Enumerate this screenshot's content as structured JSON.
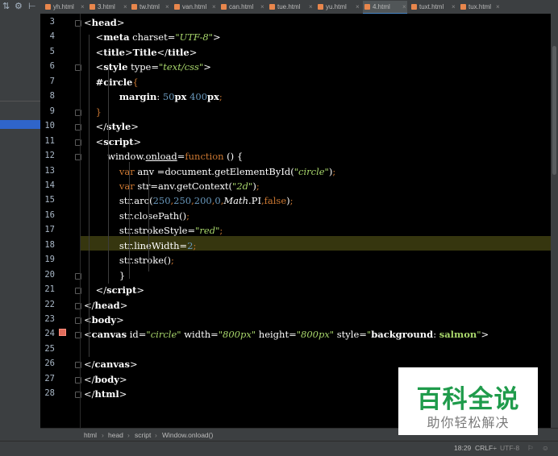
{
  "toolbar": {
    "icons": [
      "⇅",
      "⚙",
      "⊢"
    ]
  },
  "tabs": [
    {
      "label": "yh.html",
      "active": false
    },
    {
      "label": "3.html",
      "active": false
    },
    {
      "label": "tw.html",
      "active": false
    },
    {
      "label": "van.html",
      "active": false
    },
    {
      "label": "can.html",
      "active": false
    },
    {
      "label": "tue.html",
      "active": false
    },
    {
      "label": "yu.html",
      "active": false
    },
    {
      "label": "4.html",
      "active": true
    },
    {
      "label": "tuxt.html",
      "active": false
    },
    {
      "label": "tux.html",
      "active": false
    }
  ],
  "editor": {
    "lines": [
      {
        "n": "3",
        "html": "<span class=\"wh\">&lt;</span><span class=\"tg\">head</span><span class=\"wh\">&gt;</span>"
      },
      {
        "n": "4",
        "html": "    <span class=\"wh\">&lt;</span><span class=\"tg\">meta</span> <span class=\"at\">charset=</span><span class=\"st\">\"UTF-8\"</span><span class=\"wh\">&gt;</span>"
      },
      {
        "n": "5",
        "html": "    <span class=\"wh\">&lt;</span><span class=\"tg\">title</span><span class=\"wh\">&gt;</span><span class=\"bold\">Title</span><span class=\"wh\">&lt;/</span><span class=\"tg\">title</span><span class=\"wh\">&gt;</span>"
      },
      {
        "n": "6",
        "html": "    <span class=\"wh\">&lt;</span><span class=\"tg\">style</span> <span class=\"at\">type=</span><span class=\"st\">\"text/css\"</span><span class=\"wh\">&gt;</span>"
      },
      {
        "n": "7",
        "html": "    <span class=\"bold\">#circle</span><span class=\"pu\">{</span>"
      },
      {
        "n": "8",
        "html": "            <span class=\"bold\">margin</span>: <span class=\"nm\">50</span><span class=\"bold\">px</span> <span class=\"nm\">400</span><span class=\"bold\">px</span><span class=\"pu\">;</span>"
      },
      {
        "n": "9",
        "html": "    <span class=\"pu\">}</span>"
      },
      {
        "n": "10",
        "html": "    <span class=\"wh\">&lt;/</span><span class=\"tg\">style</span><span class=\"wh\">&gt;</span>"
      },
      {
        "n": "11",
        "html": "    <span class=\"wh\">&lt;</span><span class=\"tg\">script</span><span class=\"wh\">&gt;</span>"
      },
      {
        "n": "12",
        "html": "        window.<span class=\"ul\">onload</span>=<span class=\"kw\">function</span> () {"
      },
      {
        "n": "13",
        "html": "            <span class=\"kw\">var</span> anv =document.getElementById(<span class=\"st\">\"circle\"</span>)<span class=\"pu\">;</span>"
      },
      {
        "n": "14",
        "html": "            <span class=\"kw\">var</span> str=anv.getContext(<span class=\"st\">\"2d\"</span>)<span class=\"pu\">;</span>"
      },
      {
        "n": "15",
        "html": "            str.arc(<span class=\"nm\">250</span><span class=\"pu\">,</span><span class=\"nm\">250</span><span class=\"pu\">,</span><span class=\"nm\">200</span><span class=\"pu\">,</span><span class=\"nm\">0</span><span class=\"pu\">,</span><span class=\"it\">Math</span>.PI<span class=\"pu\">,</span><span class=\"kw\">false</span>)<span class=\"pu\">;</span>"
      },
      {
        "n": "16",
        "html": "            str.closePath()<span class=\"pu\">;</span>"
      },
      {
        "n": "17",
        "html": "            str.strokeStyle=<span class=\"st\">\"red\"</span><span class=\"pu\">;</span>"
      },
      {
        "n": "18",
        "html": "            str.lineWidth=<span class=\"nm\">2</span><span class=\"pu\">;</span>"
      },
      {
        "n": "19",
        "html": "            str.stroke()<span class=\"pu\">;</span>"
      },
      {
        "n": "20",
        "html": "            }"
      },
      {
        "n": "21",
        "html": "    <span class=\"wh\">&lt;/</span><span class=\"tg\">script</span><span class=\"wh\">&gt;</span>"
      },
      {
        "n": "22",
        "html": "<span class=\"wh\">&lt;/</span><span class=\"tg\">head</span><span class=\"wh\">&gt;</span>"
      },
      {
        "n": "23",
        "html": "<span class=\"wh\">&lt;</span><span class=\"tg\">body</span><span class=\"wh\">&gt;</span>"
      },
      {
        "n": "24",
        "html": "<span class=\"wh\">&lt;</span><span class=\"tg\">canvas</span> <span class=\"at\">id=</span><span class=\"st\">\"circle\"</span> <span class=\"at\">width=</span><span class=\"st\">\"800px\"</span> <span class=\"at\">height=</span><span class=\"st\">\"800px\"</span> <span class=\"at\">style=</span><span class=\"st\">\"</span><span class=\"bold\">background</span>: <span class=\"st\" style=\"font-style:normal;font-weight:bold\">salmon</span><span class=\"st\">\"</span><span class=\"wh\">&gt;</span>"
      },
      {
        "n": "25",
        "html": ""
      },
      {
        "n": "26",
        "html": "<span class=\"wh\">&lt;/</span><span class=\"tg\">canvas</span><span class=\"wh\">&gt;</span>"
      },
      {
        "n": "27",
        "html": "<span class=\"wh\">&lt;/</span><span class=\"tg\">body</span><span class=\"wh\">&gt;</span>"
      },
      {
        "n": "28",
        "html": "<span class=\"wh\">&lt;/</span><span class=\"tg\">html</span><span class=\"wh\">&gt;</span>"
      }
    ]
  },
  "breadcrumb": [
    "html",
    "head",
    "script",
    "Window.onload()"
  ],
  "status": {
    "position": "18:29",
    "line_sep": "CRLF÷",
    "encoding": "UTF-8",
    "icons": [
      "⚐",
      "☺"
    ]
  },
  "watermark": {
    "main": "百科全说",
    "sub": "助你轻松解决"
  }
}
